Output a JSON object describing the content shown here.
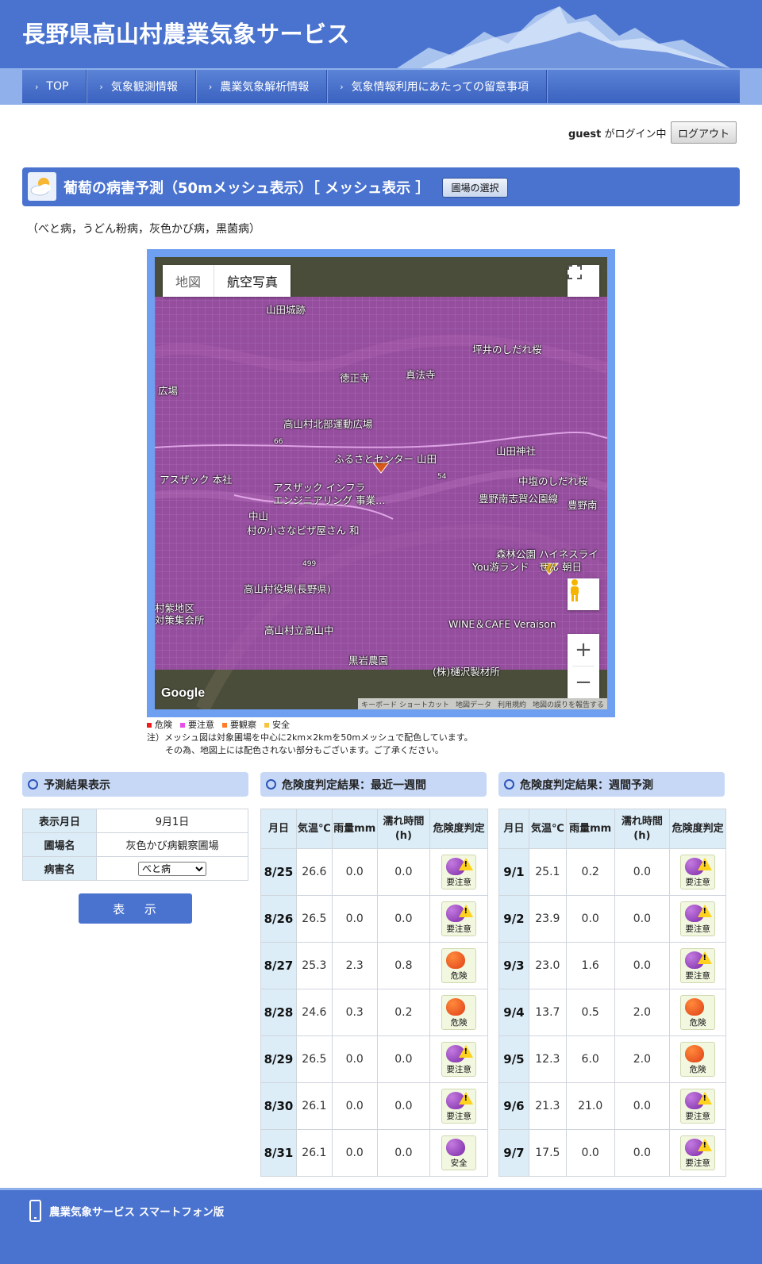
{
  "site": {
    "title": "長野県高山村農業気象サービス"
  },
  "nav": [
    {
      "label": "TOP"
    },
    {
      "label": "気象観測情報"
    },
    {
      "label": "農業気象解析情報"
    },
    {
      "label": "気象情報利用にあたっての留意事項"
    }
  ],
  "login": {
    "user": "guest",
    "suffix": "がログイン中",
    "logout_label": "ログアウト"
  },
  "page": {
    "title": "葡萄の病害予測（50mメッシュ表示）［ メッシュ表示 ］",
    "field_select_label": "圃場の選択",
    "subtitle": "（べと病，うどん粉病，灰色かび病，黒菌病）"
  },
  "map": {
    "type_map": "地図",
    "type_aerial": "航空写真",
    "google": "Google",
    "attribution": [
      "キーボード ショートカット",
      "地図データ",
      "利用規約",
      "地図の誤りを報告する"
    ],
    "overlay_color": "#b24fc4",
    "places": [
      "山田城跡",
      "坪井のしだれ桜",
      "徳正寺",
      "真法寺",
      "広場",
      "高山村北部運動広場",
      "山田神社",
      "ふるさとセンター 山田",
      "アスザック 本社",
      "アスザック インフラ",
      "エンジニアリング 事業…",
      "中塩のしだれ桜",
      "豊野南志賀公園線",
      "豊野南",
      "中山",
      "村の小さなピザ屋さん 和",
      "森林公園",
      "You游ランド",
      "ハイネスライ",
      "せん 朝日",
      "高山村役場(長野県)",
      "村紫地区",
      "対策集会所",
      "高山村立高山中",
      "WINE＆CAFE Veraison",
      "黒岩農園",
      "(株)樋沢製材所",
      "66",
      "54",
      "499"
    ]
  },
  "legend": [
    {
      "label": "危険",
      "color": "#ee1c1c"
    },
    {
      "label": "要注意",
      "color": "#e84fe8"
    },
    {
      "label": "要観察",
      "color": "#ff7d2a"
    },
    {
      "label": "安全",
      "color": "#f5c542"
    }
  ],
  "note": {
    "line1": "注）メッシュ図は対象圃場を中心に2km×2kmを50mメッシュで配色しています。",
    "line2": "その為、地図上には配色されない部分もございます。ご了承ください。"
  },
  "sections": {
    "prediction": "予測結果表示",
    "recent": "危険度判定結果：最近一週間",
    "weekly": "危険度判定結果：週間予測"
  },
  "prediction": {
    "rows": [
      {
        "key": "表示月日",
        "value": "9月1日"
      },
      {
        "key": "圃場名",
        "value": "灰色かび病観察圃場"
      },
      {
        "key": "病害名",
        "value": "べと病"
      }
    ],
    "show_label": "表 示"
  },
  "risk_headers": {
    "date_recent": "月日",
    "date_weekly": "月日",
    "temp": "気温℃",
    "rain": "雨量mm",
    "wet": "濡れ時間(h)",
    "risk": "危険度判定"
  },
  "recent": [
    {
      "date": "8/25",
      "temp": "26.6",
      "rain": "0.0",
      "wet": "0.0",
      "risk": "要注意",
      "level": "caution"
    },
    {
      "date": "8/26",
      "temp": "26.5",
      "rain": "0.0",
      "wet": "0.0",
      "risk": "要注意",
      "level": "caution"
    },
    {
      "date": "8/27",
      "temp": "25.3",
      "rain": "2.3",
      "wet": "0.8",
      "risk": "危険",
      "level": "danger"
    },
    {
      "date": "8/28",
      "temp": "24.6",
      "rain": "0.3",
      "wet": "0.2",
      "risk": "危険",
      "level": "danger"
    },
    {
      "date": "8/29",
      "temp": "26.5",
      "rain": "0.0",
      "wet": "0.0",
      "risk": "要注意",
      "level": "caution"
    },
    {
      "date": "8/30",
      "temp": "26.1",
      "rain": "0.0",
      "wet": "0.0",
      "risk": "要注意",
      "level": "caution"
    },
    {
      "date": "8/31",
      "temp": "26.1",
      "rain": "0.0",
      "wet": "0.0",
      "risk": "安全",
      "level": "safe"
    }
  ],
  "weekly": [
    {
      "date": "9/1",
      "temp": "25.1",
      "rain": "0.2",
      "wet": "0.0",
      "risk": "要注意",
      "level": "caution"
    },
    {
      "date": "9/2",
      "temp": "23.9",
      "rain": "0.0",
      "wet": "0.0",
      "risk": "要注意",
      "level": "caution"
    },
    {
      "date": "9/3",
      "temp": "23.0",
      "rain": "1.6",
      "wet": "0.0",
      "risk": "要注意",
      "level": "caution"
    },
    {
      "date": "9/4",
      "temp": "13.7",
      "rain": "0.5",
      "wet": "2.0",
      "risk": "危険",
      "level": "danger"
    },
    {
      "date": "9/5",
      "temp": "12.3",
      "rain": "6.0",
      "wet": "2.0",
      "risk": "危険",
      "level": "danger"
    },
    {
      "date": "9/6",
      "temp": "21.3",
      "rain": "21.0",
      "wet": "0.0",
      "risk": "要注意",
      "level": "caution"
    },
    {
      "date": "9/7",
      "temp": "17.5",
      "rain": "0.0",
      "wet": "0.0",
      "risk": "要注意",
      "level": "caution"
    }
  ],
  "footer": {
    "smartphone_label": "農業気象サービス スマートフォン版"
  }
}
